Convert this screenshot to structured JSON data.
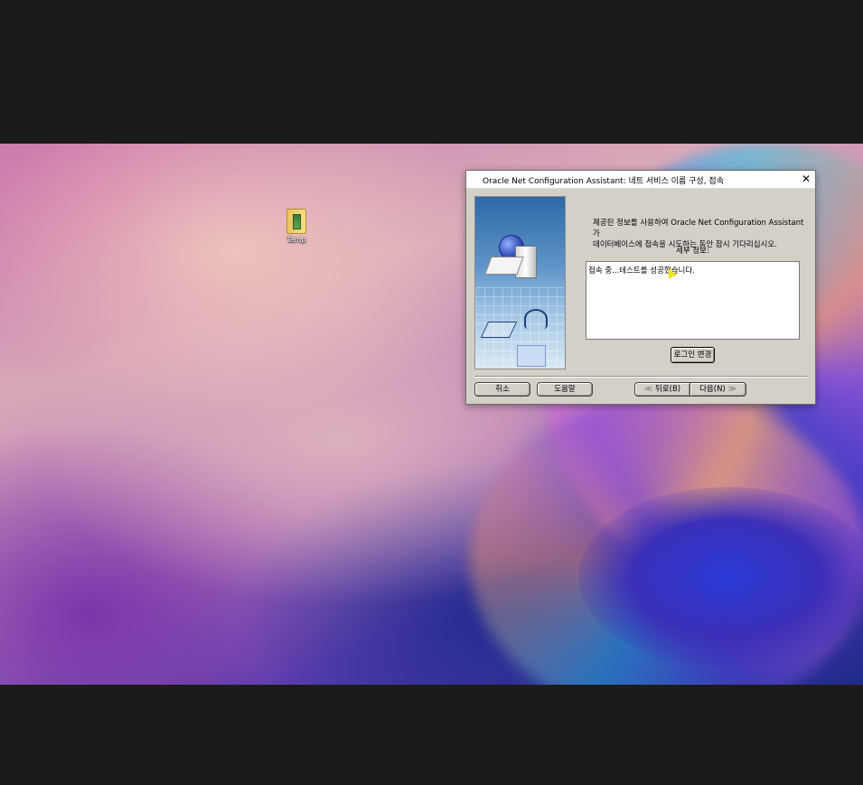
{
  "desktop": {
    "icons": [
      {
        "label": "Temp"
      }
    ]
  },
  "dialog": {
    "title": "Oracle Net Configuration Assistant: 네트 서비스 이름 구성, 접속",
    "message_line1": "제공된 정보를 사용하여 Oracle Net Configuration Assistant가",
    "message_line2": "데이터베이스에 접속을 시도하는 동안 잠시 기다리십시오.",
    "details_label": "세부 정보:",
    "details_text": "접속 중...테스트를 성공했습니다.",
    "login_change_label": "로그인 변경",
    "cancel_label": "취소",
    "help_label": "도움말",
    "back_label": "뒤로(B)",
    "next_label": "다음(N)",
    "close_icon": "close-icon"
  }
}
